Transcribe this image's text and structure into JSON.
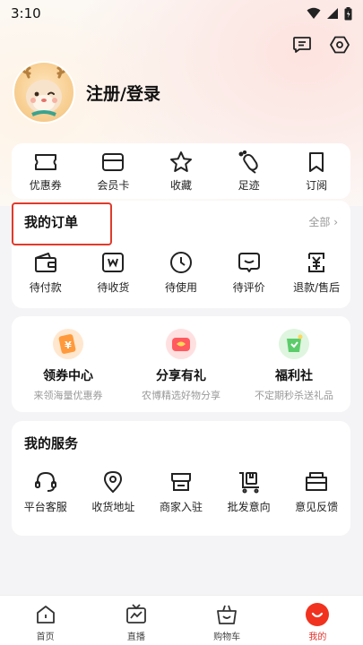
{
  "status_bar": {
    "time": "3:10"
  },
  "profile": {
    "login_label": "注册/登录"
  },
  "quick_links": [
    {
      "label": "优惠券",
      "icon": "ticket-icon"
    },
    {
      "label": "会员卡",
      "icon": "card-icon"
    },
    {
      "label": "收藏",
      "icon": "star-icon"
    },
    {
      "label": "足迹",
      "icon": "footprint-icon"
    },
    {
      "label": "订阅",
      "icon": "bookmark-icon"
    }
  ],
  "orders": {
    "title": "我的订单",
    "all_label": "全部 ›",
    "items": [
      {
        "label": "待付款",
        "icon": "wallet-icon"
      },
      {
        "label": "待收货",
        "icon": "package-icon"
      },
      {
        "label": "待使用",
        "icon": "clock-icon"
      },
      {
        "label": "待评价",
        "icon": "comment-icon"
      },
      {
        "label": "退款/售后",
        "icon": "refund-icon"
      }
    ]
  },
  "promos": [
    {
      "title": "领券中心",
      "sub": "来领海量优惠券",
      "icon": "coupon-center-icon",
      "color": "#ff9a3c"
    },
    {
      "title": "分享有礼",
      "sub": "农博精选好物分享",
      "icon": "gift-share-icon",
      "color": "#ff5a5f"
    },
    {
      "title": "福利社",
      "sub": "不定期秒杀送礼品",
      "icon": "welfare-icon",
      "color": "#5ccc6b"
    }
  ],
  "services": {
    "title": "我的服务",
    "items": [
      {
        "label": "平台客服",
        "icon": "headset-icon"
      },
      {
        "label": "收货地址",
        "icon": "location-icon"
      },
      {
        "label": "商家入驻",
        "icon": "store-icon"
      },
      {
        "label": "批发意向",
        "icon": "cart-wholesale-icon"
      },
      {
        "label": "意见反馈",
        "icon": "feedback-icon"
      }
    ]
  },
  "tabbar": [
    {
      "label": "首页",
      "icon": "home-icon",
      "active": false
    },
    {
      "label": "直播",
      "icon": "tv-icon",
      "active": false
    },
    {
      "label": "购物车",
      "icon": "basket-icon",
      "active": false
    },
    {
      "label": "我的",
      "icon": "profile-tab-icon",
      "active": true
    }
  ],
  "colors": {
    "accent": "#e0302a",
    "highlight_box": "#e03a2b"
  }
}
